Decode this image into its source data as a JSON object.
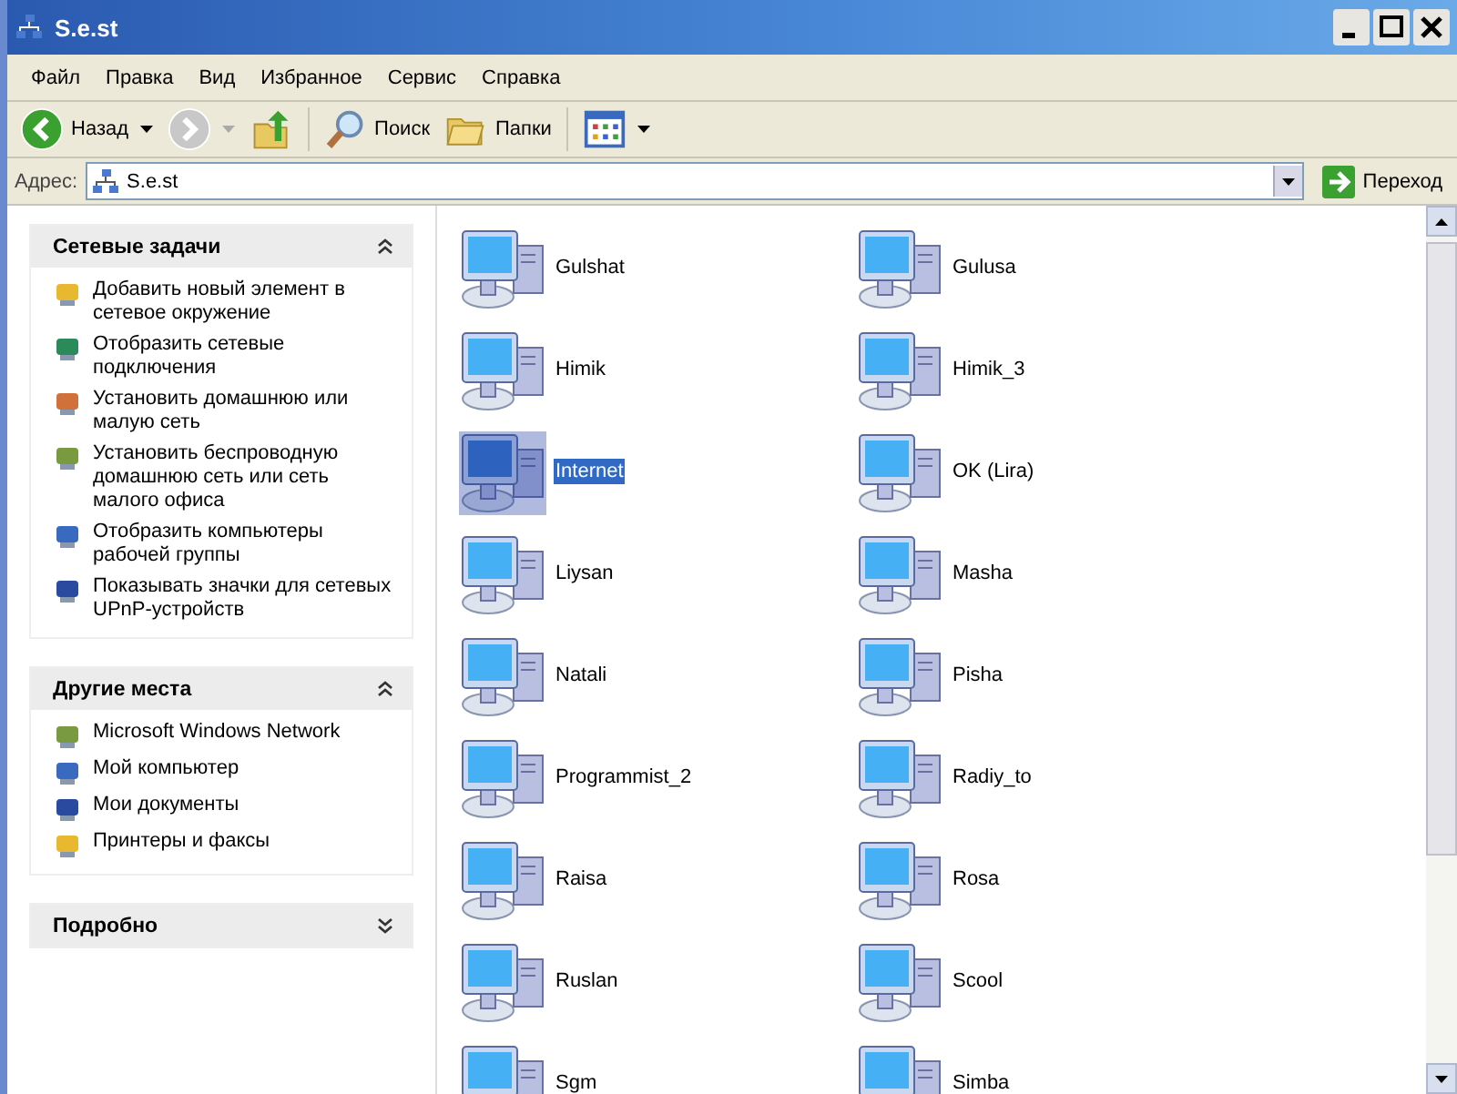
{
  "window": {
    "title": "S.e.st"
  },
  "menu": [
    "Файл",
    "Правка",
    "Вид",
    "Избранное",
    "Сервис",
    "Справка"
  ],
  "toolbar": [
    {
      "kind": "back",
      "label": "Назад",
      "disabled": false
    },
    {
      "kind": "forward",
      "disabled": true
    },
    {
      "kind": "up"
    },
    {
      "kind": "search",
      "label": "Поиск"
    },
    {
      "kind": "folders",
      "label": "Папки"
    },
    {
      "kind": "views"
    }
  ],
  "address": {
    "label": "Адрес:",
    "value": "S.e.st",
    "go": "Переход"
  },
  "sidebar": [
    {
      "title": "Сетевые задачи",
      "expanded": true,
      "items": [
        "Добавить новый элемент в сетевое окружение",
        "Отобразить сетевые подключения",
        "Установить домашнюю или малую сеть",
        "Установить беспроводную домашнюю сеть или сеть малого офиса",
        "Отобразить компьютеры рабочей группы",
        "Показывать значки для сетевых UPnP-устройств"
      ]
    },
    {
      "title": "Другие места",
      "expanded": true,
      "items": [
        "Microsoft Windows Network",
        "Мой компьютер",
        "Мои документы",
        "Принтеры и факсы"
      ]
    },
    {
      "title": "Подробно",
      "expanded": false
    }
  ],
  "computers": [
    {
      "name": "Gulshat",
      "selected": false
    },
    {
      "name": "Gulusa",
      "selected": false
    },
    {
      "name": "Himik",
      "selected": false
    },
    {
      "name": "Himik_3",
      "selected": false
    },
    {
      "name": "Internet",
      "selected": true
    },
    {
      "name": "OK (Lira)",
      "selected": false
    },
    {
      "name": "Liysan",
      "selected": false
    },
    {
      "name": "Masha",
      "selected": false
    },
    {
      "name": "Natali",
      "selected": false
    },
    {
      "name": "Pisha",
      "selected": false
    },
    {
      "name": "Programmist_2",
      "selected": false
    },
    {
      "name": "Radiy_to",
      "selected": false
    },
    {
      "name": "Raisa",
      "selected": false
    },
    {
      "name": "Rosa",
      "selected": false
    },
    {
      "name": "Ruslan",
      "selected": false
    },
    {
      "name": "Scool",
      "selected": false
    },
    {
      "name": "Sgm",
      "selected": false
    },
    {
      "name": "Simba",
      "selected": false
    }
  ]
}
